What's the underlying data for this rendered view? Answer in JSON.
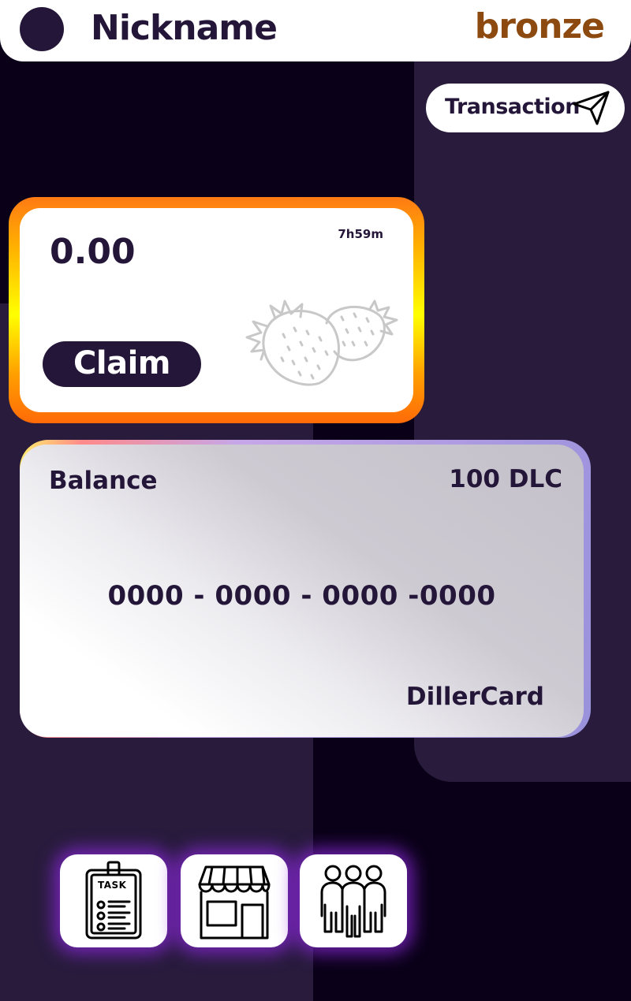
{
  "header": {
    "nickname": "Nickname",
    "rank": "bronze"
  },
  "transaction_button": {
    "label": "Transaction",
    "icon": "paper-plane-icon"
  },
  "claim_card": {
    "amount": "0.00",
    "timer": "7h59m",
    "claim_label": "Claim",
    "illustration": "strawberries-icon"
  },
  "balance_card": {
    "balance_label": "Balance",
    "balance_value": "100 DLC",
    "card_number": "0000 - 0000 - 0000 -0000",
    "brand": "DillerCard"
  },
  "nav": {
    "task_icon_text": "TASK",
    "items": [
      {
        "icon": "task-clipboard-icon"
      },
      {
        "icon": "shop-icon"
      },
      {
        "icon": "friends-icon"
      }
    ]
  },
  "colors": {
    "background": "#0a0118",
    "panel": "#281b3c",
    "text_dark": "#241638",
    "rank_bronze": "#8c4a10",
    "claim_border_top": "#ff7a14",
    "claim_border_mid": "#ffff00",
    "nav_glow": "#8c28dc"
  }
}
